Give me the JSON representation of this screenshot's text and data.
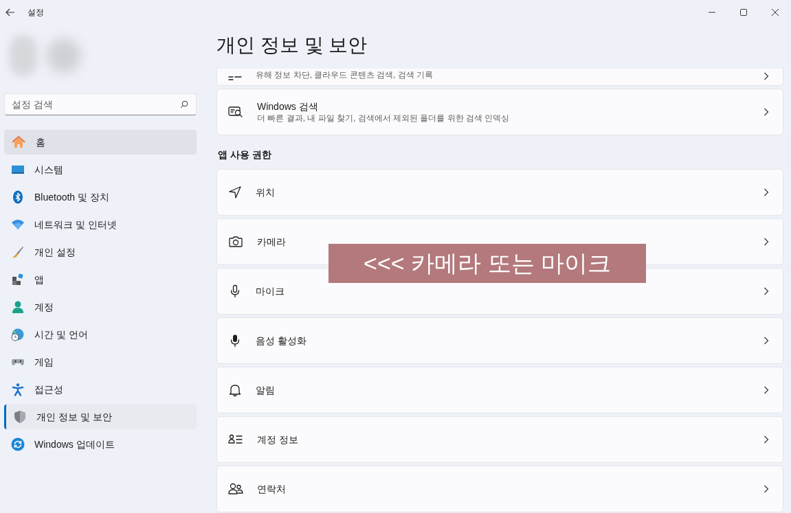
{
  "window": {
    "title": "설정"
  },
  "search": {
    "placeholder": "설정 검색"
  },
  "sidebar": {
    "items": [
      {
        "label": "홈",
        "kind": "home",
        "selected": false,
        "hovered": true
      },
      {
        "label": "시스템",
        "kind": "system",
        "selected": false,
        "hovered": false
      },
      {
        "label": "Bluetooth 및 장치",
        "kind": "bluetooth",
        "selected": false,
        "hovered": false
      },
      {
        "label": "네트워크 및 인터넷",
        "kind": "wifi",
        "selected": false,
        "hovered": false
      },
      {
        "label": "개인 설정",
        "kind": "brush",
        "selected": false,
        "hovered": false
      },
      {
        "label": "앱",
        "kind": "apps",
        "selected": false,
        "hovered": false
      },
      {
        "label": "계정",
        "kind": "person",
        "selected": false,
        "hovered": false
      },
      {
        "label": "시간 및 언어",
        "kind": "globe",
        "selected": false,
        "hovered": false
      },
      {
        "label": "게임",
        "kind": "gamepad",
        "selected": false,
        "hovered": false
      },
      {
        "label": "접근성",
        "kind": "access",
        "selected": false,
        "hovered": false
      },
      {
        "label": "개인 정보 및 보안",
        "kind": "shield",
        "selected": true,
        "hovered": false
      },
      {
        "label": "Windows 업데이트",
        "kind": "update",
        "selected": false,
        "hovered": false
      }
    ]
  },
  "page_title": "개인 정보 및 보안",
  "top_cards": [
    {
      "kind": "list",
      "subtitle": "유해 정보 차단, 클라우드 콘텐츠 검색, 검색 기록"
    },
    {
      "kind": "search-doc",
      "title": "Windows 검색",
      "subtitle": "더 빠른 결과, 내 파일 찾기, 검색에서 제외된 폴더를 위한 검색 인덱싱"
    }
  ],
  "section_heading": "앱 사용 권한",
  "permissions": [
    {
      "label": "위치",
      "kind": "location"
    },
    {
      "label": "카메라",
      "kind": "camera"
    },
    {
      "label": "마이크",
      "kind": "mic"
    },
    {
      "label": "음성 활성화",
      "kind": "mic-filled"
    },
    {
      "label": "알림",
      "kind": "bell"
    },
    {
      "label": "계정 정보",
      "kind": "account-info"
    },
    {
      "label": "연락처",
      "kind": "contacts"
    }
  ],
  "annotation": {
    "text": "<<< 카메라 또는 마이크"
  }
}
